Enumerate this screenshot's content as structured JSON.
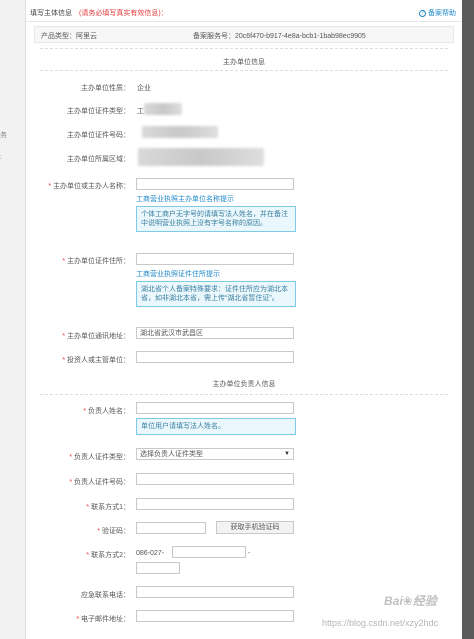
{
  "header": {
    "title": "填写主体信息",
    "note": "(请务必填写真实有效信息)：",
    "help_label": "备案帮助",
    "help_icon": "question-circle-icon"
  },
  "product": {
    "type_label": "产品类型：阿里云",
    "service_label": "备案服务号：20c6f470-b917-4e8a-bcb1-1bab98ec9905"
  },
  "section_org": {
    "title": "主办单位信息",
    "nature_label": "主办单位性质：",
    "nature_value": "企业",
    "cert_type_label": "主办单位证件类型：",
    "cert_type_value": "工",
    "cert_no_label": "主办单位证件号码：",
    "region_label": "主办单位所属区域：",
    "name_label": "主办单位或主办人名称：",
    "name_link": "工商营业执照主办单位名称提示",
    "name_tip": "个体工商户无字号的请填写法人姓名，并在备注中说明营业执照上没有字号名称的原因。",
    "cert_addr_label": "主办单位证件住所：",
    "cert_addr_link": "工商营业执照证件住所提示",
    "cert_addr_tip": "湖北省个人备案特殊要求：证件住所应为湖北本省，如非湖北本省，需上传“湖北省暂住证”。",
    "mail_addr_label": "主办单位通讯地址：",
    "mail_addr_value": "湖北省武汉市武昌区",
    "investor_label": "投资人或主管单位："
  },
  "section_person": {
    "title": "主办单位负责人信息",
    "name_label": "负责人姓名：",
    "name_tip": "单位用户请填写法人姓名。",
    "cert_type_label": "负责人证件类型：",
    "cert_type_value": "选择负责人证件类型",
    "cert_no_label": "负责人证件号码：",
    "contact1_label": "联系方式1：",
    "verify_label": "验证码：",
    "verify_button": "获取手机验证码",
    "contact2_label": "联系方式2：",
    "contact2_prefix": "086-027-",
    "contact2_dash": "-",
    "emergency_label": "应急联系电话：",
    "email_label": "电子邮件地址："
  },
  "watermark": {
    "url": "https://blog.csdn.net/xzy2hdc"
  }
}
